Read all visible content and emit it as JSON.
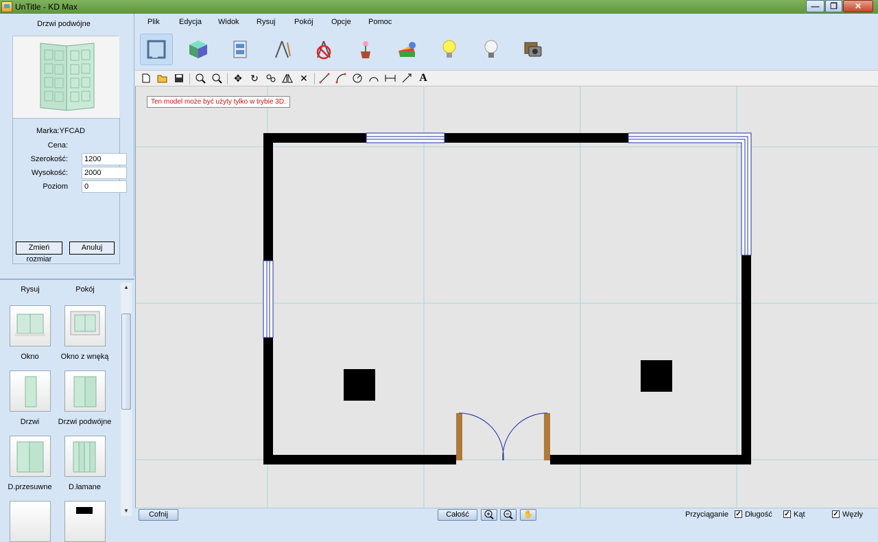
{
  "window": {
    "title": "UnTitle - KD Max",
    "min": "—",
    "max": "❐",
    "close": "✕"
  },
  "props": {
    "title": "Drzwi podwójne",
    "brand": "Marka:YFCAD",
    "price_label": "Cena:",
    "width_label": "Szerokość:",
    "width_value": "1200",
    "height_label": "Wysokość:",
    "height_value": "2000",
    "level_label": "Poziom",
    "level_value": "0",
    "resize_button": "Zmień rozmiar",
    "cancel_button": "Anuluj"
  },
  "palette": {
    "tabs": [
      "Rysuj",
      "Pokój"
    ],
    "items": [
      "Okno",
      "Okno z wnęką",
      "Drzwi",
      "Drzwi podwójne",
      "D.przesuwne",
      "D.łamane"
    ]
  },
  "menu": [
    "Plik",
    "Edycja",
    "Widok",
    "Rysuj",
    "Pokój",
    "Opcje",
    "Pomoc"
  ],
  "toolbar_icons": [
    "plan-view-icon",
    "3d-cube-icon",
    "cabinet-icon",
    "drawing-compass-icon",
    "no-compass-icon",
    "flower-pot-icon",
    "color-palette-icon",
    "light-on-icon",
    "light-off-icon",
    "camera-render-icon"
  ],
  "canvas": {
    "notice": "Ten model może być użyty tylko w trybie 3D."
  },
  "status": {
    "undo": "Cofnij",
    "whole": "Całość",
    "snap": "Przyciąganie",
    "length": "Długość",
    "angle": "Kąt",
    "nodes": "Węzły",
    "check": "✓"
  }
}
